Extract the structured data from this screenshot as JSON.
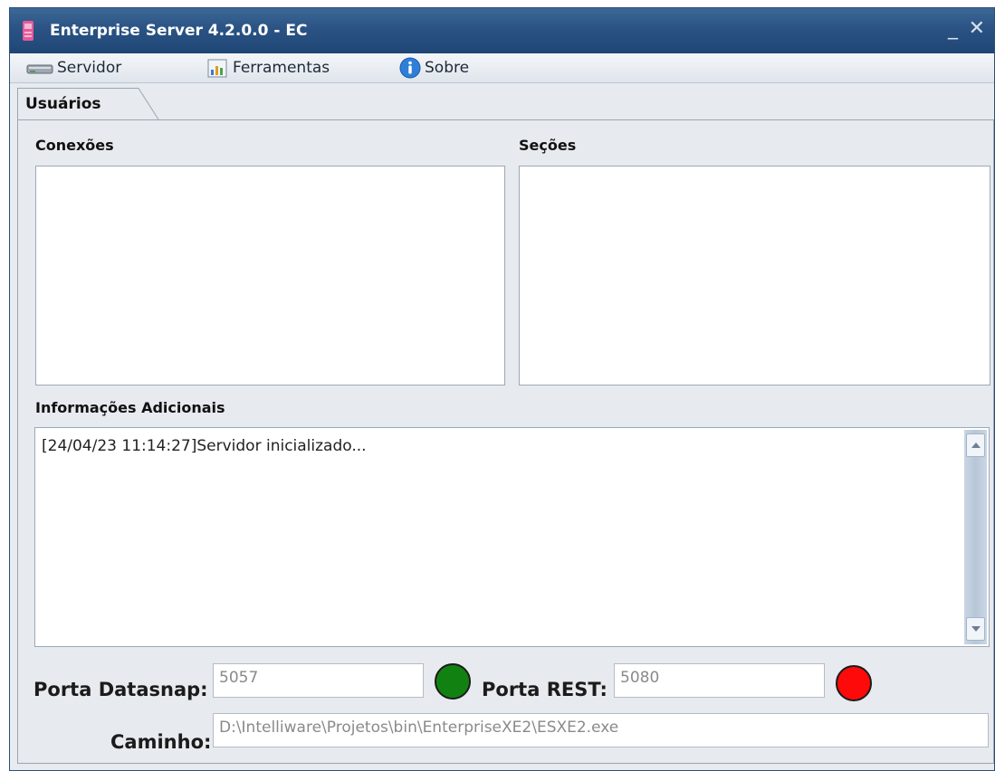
{
  "window": {
    "title": "Enterprise Server 4.2.0.0 - EC",
    "minimize_glyph": "_",
    "close_glyph": "✕"
  },
  "menu": {
    "items": [
      {
        "label": "Servidor",
        "icon": "server-icon"
      },
      {
        "label": "Ferramentas",
        "icon": "chart-tools-icon"
      },
      {
        "label": "Sobre",
        "icon": "info-icon"
      }
    ]
  },
  "tabs": [
    {
      "label": "Usuários",
      "active": true
    }
  ],
  "panel": {
    "connections_label": "Conexões",
    "sessions_label": "Seções",
    "info_label": "Informações Adicionais",
    "log_lines": [
      "[24/04/23 11:14:27]Servidor inicializado..."
    ]
  },
  "footer": {
    "datasnap_label": "Porta Datasnap:",
    "datasnap_value": "5057",
    "datasnap_status": "online",
    "datasnap_status_color": "#118211",
    "rest_label": "Porta REST:",
    "rest_value": "5080",
    "rest_status": "offline",
    "rest_status_color": "#ff0a0a",
    "path_label": "Caminho:",
    "path_value": "D:\\Intelliware\\Projetos\\bin\\EnterpriseXE2\\ESXE2.exe"
  },
  "colors": {
    "titlebar": "#2a5384",
    "panel_bg": "#e7eaee"
  }
}
